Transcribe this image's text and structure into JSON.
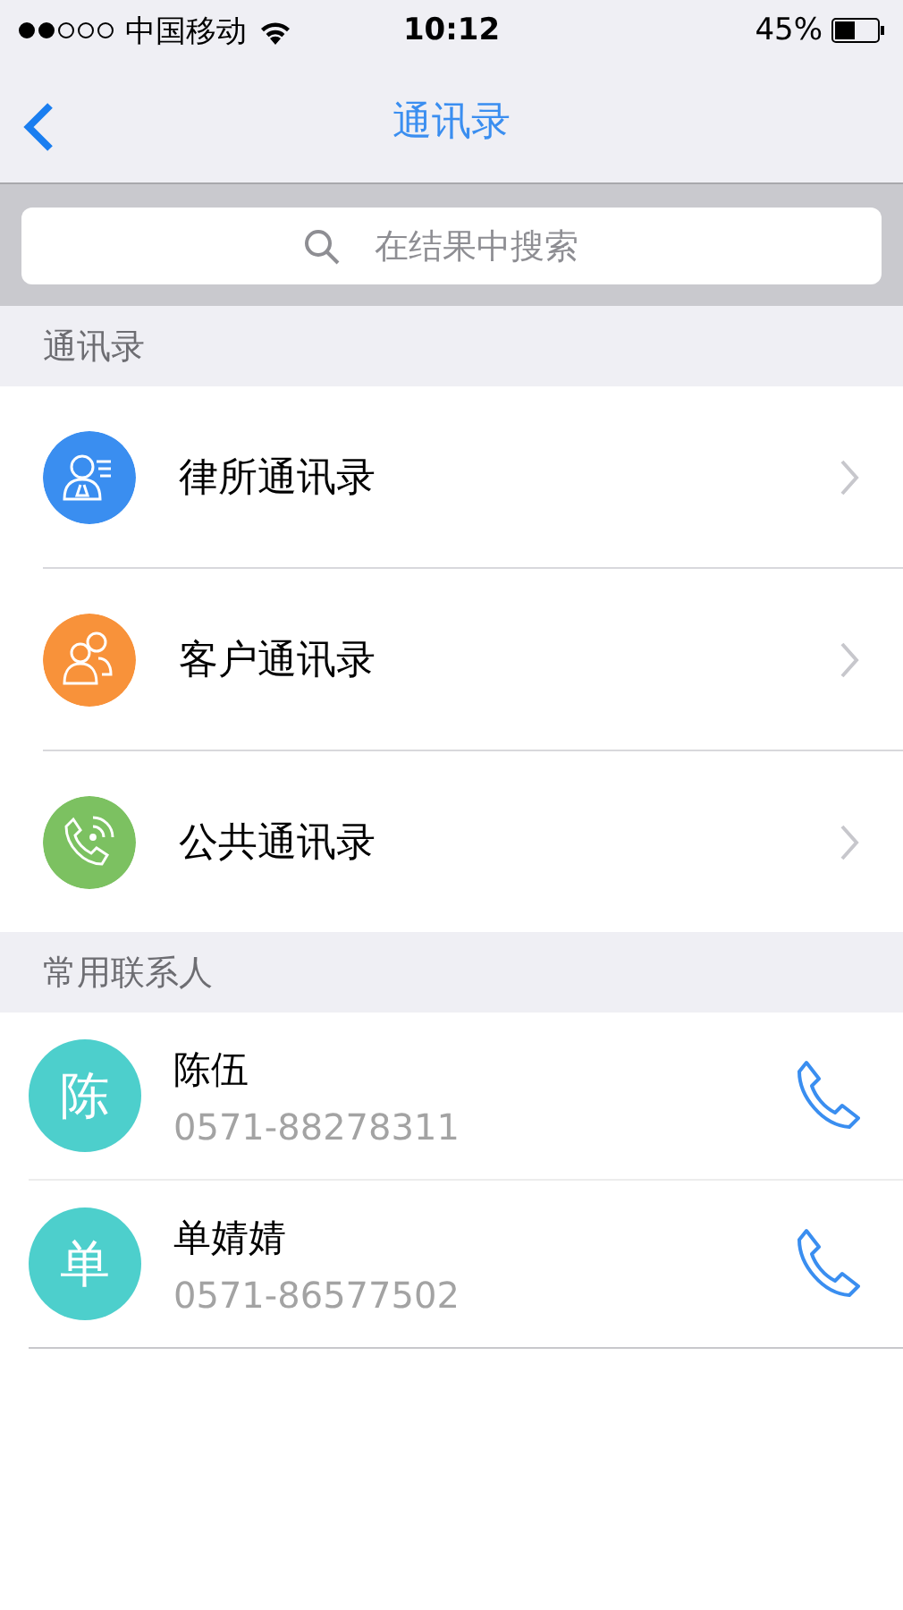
{
  "status_bar": {
    "carrier": "中国移动",
    "time": "10:12",
    "battery": "45%"
  },
  "nav": {
    "title": "通讯录"
  },
  "search": {
    "placeholder": "在结果中搜索"
  },
  "directory": {
    "header": "通讯录",
    "items": [
      {
        "label": "律所通讯录",
        "kind": "firm",
        "color": "#3a8ef0"
      },
      {
        "label": "客户通讯录",
        "kind": "clients",
        "color": "#f8923a"
      },
      {
        "label": "公共通讯录",
        "kind": "public",
        "color": "#7cc161"
      }
    ]
  },
  "contacts": {
    "header": "常用联系人",
    "items": [
      {
        "initial": "陈",
        "name": "陈伍",
        "phone": "0571-88278311"
      },
      {
        "initial": "单",
        "name": "单婧婧",
        "phone": "0571-86577502"
      }
    ]
  }
}
